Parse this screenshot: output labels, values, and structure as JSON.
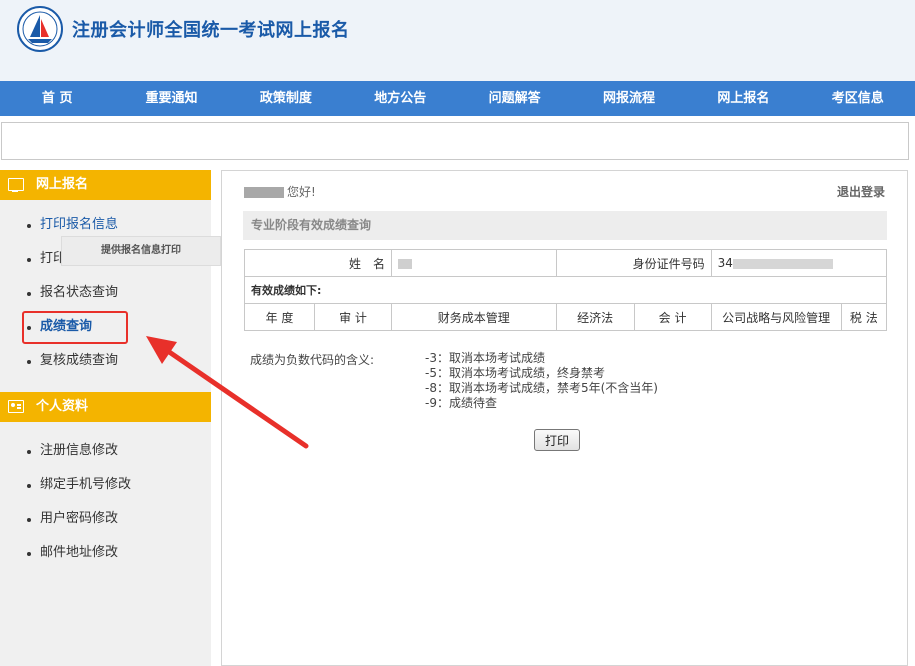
{
  "header": {
    "title": "注册会计师全国统一考试网上报名",
    "logo_icon": "sailboat-emblem-icon"
  },
  "nav": [
    "首 页",
    "重要通知",
    "政策制度",
    "地方公告",
    "问题解答",
    "网报流程",
    "网上报名",
    "考区信息"
  ],
  "sidebar": {
    "section1": {
      "title": "网上报名",
      "icon": "screen-icon",
      "items": [
        "打印报名信息",
        "打印",
        "报名状态查询",
        "成绩查询",
        "复核成绩查询"
      ]
    },
    "tooltip": "提供报名信息打印",
    "section2": {
      "title": "个人资料",
      "icon": "id-card-icon",
      "items": [
        "注册信息修改",
        "绑定手机号修改",
        "用户密码修改",
        "邮件地址修改"
      ]
    }
  },
  "content": {
    "greeting": "您好!",
    "logout": "退出登录",
    "section_title": "专业阶段有效成绩查询",
    "name_label": "姓　名",
    "id_label": "身份证件号码",
    "id_value_prefix": "34",
    "table_caption": "有效成绩如下:",
    "columns": [
      "年 度",
      "审 计",
      "财务成本管理",
      "经济法",
      "会 计",
      "公司战略与风险管理",
      "税 法"
    ],
    "legend_label": "成绩为负数代码的含义:",
    "legend_items": [
      "-3：取消本场考试成绩",
      "-5：取消本场考试成绩，终身禁考",
      "-8：取消本场考试成绩，禁考5年(不含当年)",
      "-9：成绩待查"
    ],
    "print_label": "打印"
  },
  "colors": {
    "nav_bg": "#3a7fd0",
    "sidebar_header": "#f4b400",
    "highlight": "#e8302a",
    "title_blue": "#1a5aa8"
  }
}
